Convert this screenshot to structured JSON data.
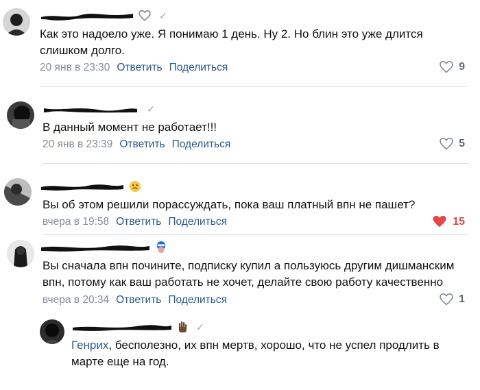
{
  "comments": [
    {
      "text": "Как это надоело уже. Я понимаю 1 день. Ну 2. Но блин это уже длится слишком долго.",
      "time": "20 янв в 23:30",
      "reply": "Ответить",
      "share": "Поделиться",
      "likes": "9",
      "liked": false
    },
    {
      "text": "В данный момент не работает!!!",
      "time": "20 янв в 23:39",
      "reply": "Ответить",
      "share": "Поделиться",
      "likes": "5",
      "liked": false
    },
    {
      "text": "Вы об этом решили порассуждать, пока ваш платный впн не пашет?",
      "time": "вчера в 19:58",
      "reply": "Ответить",
      "share": "Поделиться",
      "likes": "15",
      "liked": true
    },
    {
      "text": "Вы сначала впн почините, подписку купил а пользуюсь другим дишманским впн, потому как ваш работать не хочет, делайте свою работу качественно",
      "time": "вчера в 20:34",
      "reply": "Ответить",
      "share": "Поделиться",
      "likes": "1",
      "liked": false
    }
  ],
  "nested_reply": {
    "mention": "Генрих",
    "text": ", бесполезно, их впн мертв, хорошо, что не успел продлить в марте еще на год."
  },
  "icons": {
    "heart": "heart-icon",
    "verified": "checkmark-icon",
    "emoji_smile": "emoji-icon"
  },
  "colors": {
    "link": "#2a5885",
    "meta": "#818c99",
    "liked": "#e64646",
    "divider": "#dce1e6"
  }
}
